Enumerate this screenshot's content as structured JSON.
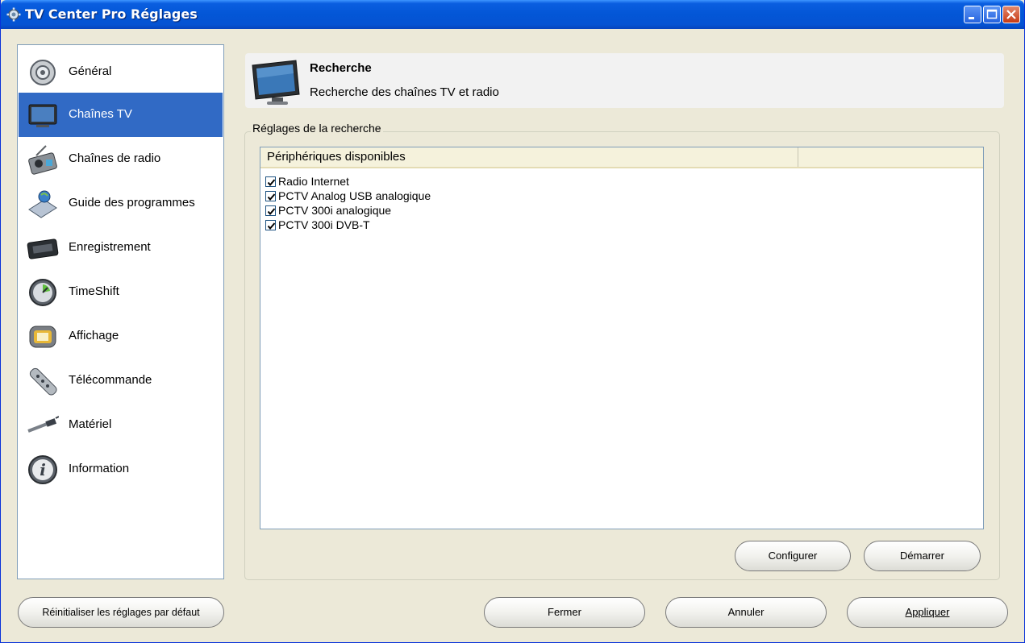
{
  "window": {
    "title": "TV Center Pro Réglages"
  },
  "sidebar": {
    "items": [
      {
        "label": "Général",
        "icon": "gear-icon"
      },
      {
        "label": "Chaînes TV",
        "icon": "tv-icon",
        "active": true
      },
      {
        "label": "Chaînes de radio",
        "icon": "radio-icon"
      },
      {
        "label": "Guide des programmes",
        "icon": "program-guide-icon"
      },
      {
        "label": "Enregistrement",
        "icon": "videotape-icon"
      },
      {
        "label": "TimeShift",
        "icon": "clock-icon"
      },
      {
        "label": "Affichage",
        "icon": "display-icon"
      },
      {
        "label": "Télécommande",
        "icon": "remote-control-icon"
      },
      {
        "label": "Matériel",
        "icon": "hardware-icon"
      },
      {
        "label": "Information",
        "icon": "information-icon"
      }
    ]
  },
  "header": {
    "title": "Recherche",
    "subtitle": "Recherche des chaînes TV et radio"
  },
  "group": {
    "legend": "Réglages de la recherche",
    "column_header": "Périphériques disponibles",
    "devices": [
      {
        "label": "Radio Internet",
        "checked": true
      },
      {
        "label": "PCTV Analog USB analogique",
        "checked": true
      },
      {
        "label": "PCTV 300i analogique",
        "checked": true
      },
      {
        "label": "PCTV 300i DVB-T",
        "checked": true
      }
    ],
    "configure_label": "Configurer",
    "start_label": "Démarrer"
  },
  "footer": {
    "reset_label": "Réinitialiser les réglages par défaut",
    "close_label": "Fermer",
    "cancel_label": "Annuler",
    "apply_label": "Appliquer"
  }
}
